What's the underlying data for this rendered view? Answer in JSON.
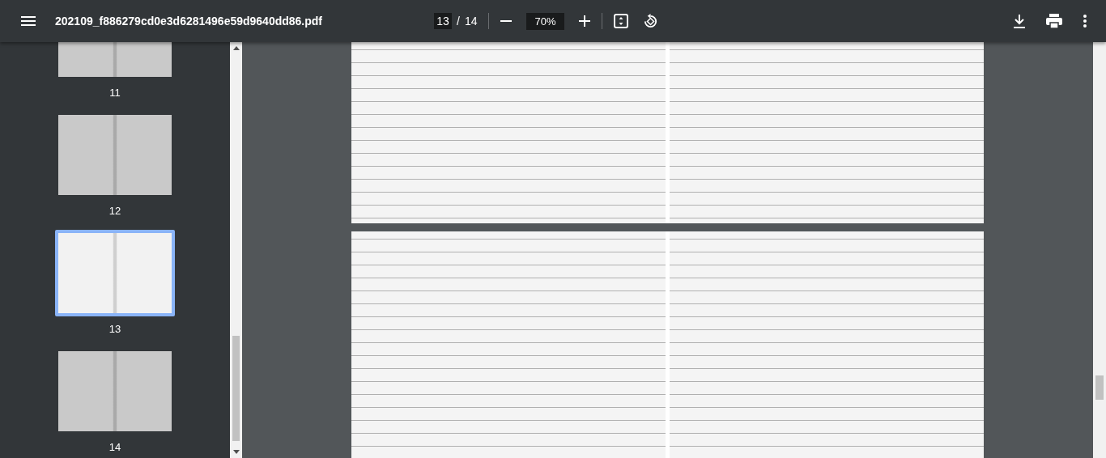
{
  "toolbar": {
    "title": "202109_f886279cd0e3d6281496e59d9640dd86.pdf",
    "page_current": "13",
    "page_separator": "/",
    "page_total": "14",
    "zoom": "70%"
  },
  "thumbnails": [
    {
      "label": "11",
      "selected": false
    },
    {
      "label": "12",
      "selected": false
    },
    {
      "label": "13",
      "selected": true
    },
    {
      "label": "14",
      "selected": false
    }
  ]
}
